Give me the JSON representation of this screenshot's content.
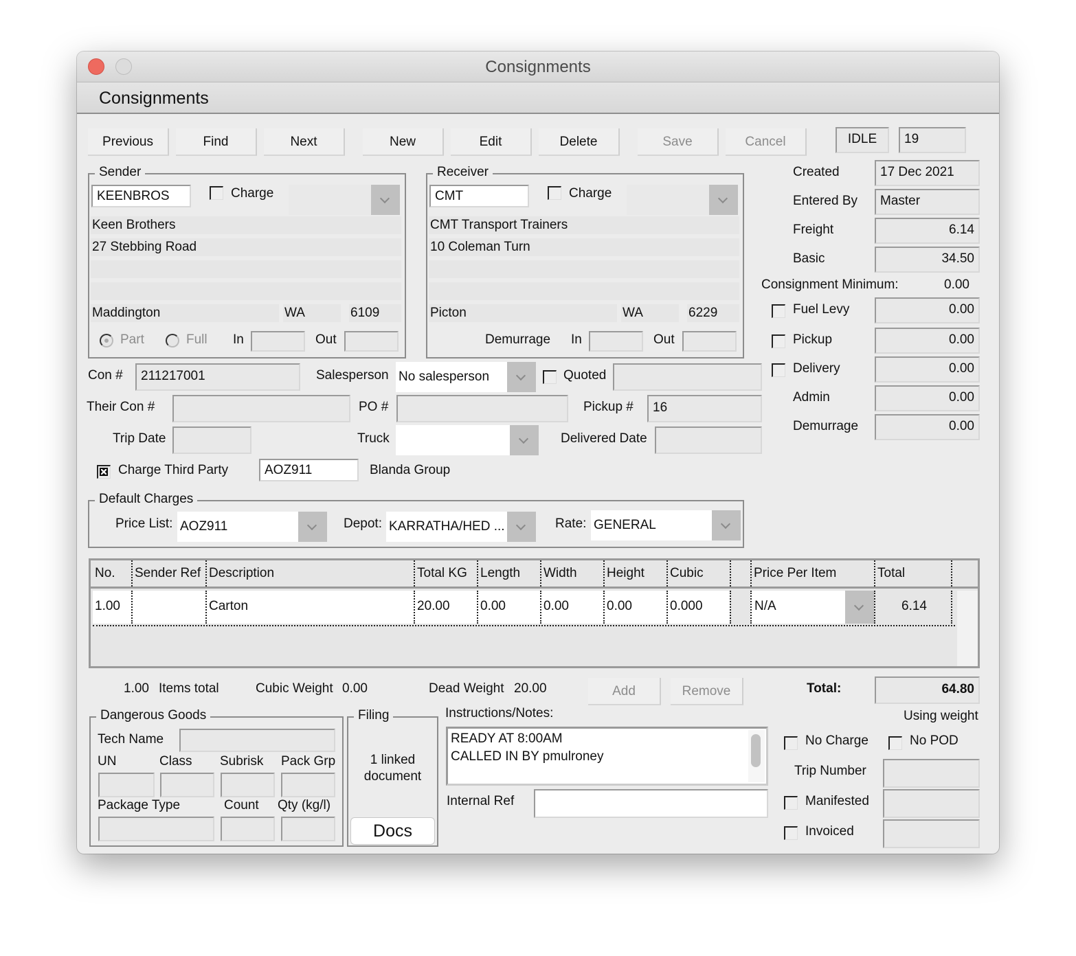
{
  "window": {
    "title": "Consignments",
    "header": "Consignments"
  },
  "toolbar": {
    "previous": "Previous",
    "find": "Find",
    "next": "Next",
    "new": "New",
    "edit": "Edit",
    "delete": "Delete",
    "save": "Save",
    "cancel": "Cancel",
    "status": "IDLE",
    "record_number": "19"
  },
  "sender": {
    "title": "Sender",
    "code": "KEENBROS",
    "charge_label": "Charge",
    "charge_checked": false,
    "name": "Keen Brothers",
    "address1": "27 Stebbing Road",
    "address2": "",
    "address3": "",
    "suburb": "Maddington",
    "state": "WA",
    "postcode": "6109",
    "part_label": "Part",
    "full_label": "Full",
    "in_label": "In",
    "out_label": "Out",
    "in_value": "",
    "out_value": ""
  },
  "receiver": {
    "title": "Receiver",
    "code": "CMT",
    "charge_label": "Charge",
    "charge_checked": false,
    "name": "CMT Transport Trainers",
    "address1": "10 Coleman Turn",
    "address2": "",
    "address3": "",
    "suburb": "Picton",
    "state": "WA",
    "postcode": "6229",
    "demurrage_label": "Demurrage",
    "in_label": "In",
    "out_label": "Out",
    "in_value": "",
    "out_value": ""
  },
  "summary": {
    "created_label": "Created",
    "created": "17 Dec 2021",
    "entered_by_label": "Entered By",
    "entered_by": "Master",
    "freight_label": "Freight",
    "freight": "6.14",
    "basic_label": "Basic",
    "basic": "34.50",
    "minimum_label": "Consignment Minimum:",
    "minimum": "0.00",
    "fuel_levy_label": "Fuel Levy",
    "fuel_levy": "0.00",
    "pickup_label": "Pickup",
    "pickup": "0.00",
    "delivery_label": "Delivery",
    "delivery": "0.00",
    "admin_label": "Admin",
    "admin": "0.00",
    "demurrage_label": "Demurrage",
    "demurrage": "0.00"
  },
  "details": {
    "con_label": "Con #",
    "con": "211217001",
    "salesperson_label": "Salesperson",
    "salesperson": "No salesperson",
    "quoted_label": "Quoted",
    "quoted_value": "",
    "their_con_label": "Their Con #",
    "their_con": "",
    "po_label": "PO #",
    "po": "",
    "pickup_no_label": "Pickup #",
    "pickup_no": "16",
    "trip_date_label": "Trip Date",
    "trip_date": "",
    "truck_label": "Truck",
    "truck": "",
    "delivered_date_label": "Delivered Date",
    "delivered_date": "",
    "third_party_label": "Charge Third Party",
    "third_party_checked": true,
    "third_party_code": "AOZ911",
    "third_party_name": "Blanda Group"
  },
  "default_charges": {
    "title": "Default Charges",
    "price_list_label": "Price List:",
    "price_list": "AOZ911",
    "depot_label": "Depot:",
    "depot": "KARRATHA/HED ...",
    "rate_label": "Rate:",
    "rate": "GENERAL"
  },
  "items": {
    "columns": [
      "No.",
      "Sender Ref",
      "Description",
      "Total KG",
      "Length",
      "Width",
      "Height",
      "Cubic",
      "",
      "Price Per Item",
      "Total"
    ],
    "rows": [
      {
        "no": "1.00",
        "sender_ref": "",
        "description": "Carton",
        "total_kg": "20.00",
        "length": "0.00",
        "width": "0.00",
        "height": "0.00",
        "cubic": "0.000",
        "price_per_item": "N/A",
        "total": "6.14"
      }
    ]
  },
  "totals": {
    "items_total_value": "1.00",
    "items_total_label": "Items total",
    "cubic_weight_label": "Cubic Weight",
    "cubic_weight": "0.00",
    "dead_weight_label": "Dead Weight",
    "dead_weight": "20.00",
    "add": "Add",
    "remove": "Remove",
    "total_label": "Total:",
    "total": "64.80",
    "using": "Using weight"
  },
  "dangerous_goods": {
    "title": "Dangerous Goods",
    "tech_name_label": "Tech Name",
    "un_label": "UN",
    "class_label": "Class",
    "subrisk_label": "Subrisk",
    "pack_grp_label": "Pack Grp",
    "package_type_label": "Package Type",
    "count_label": "Count",
    "qty_label": "Qty (kg/l)"
  },
  "filing": {
    "title": "Filing",
    "linked_line1": "1 linked",
    "linked_line2": "document",
    "docs": "Docs"
  },
  "notes": {
    "label": "Instructions/Notes:",
    "line1": "READY AT 8:00AM",
    "line2": "CALLED IN BY pmulroney",
    "internal_ref_label": "Internal Ref",
    "internal_ref": ""
  },
  "flags": {
    "no_charge_label": "No Charge",
    "no_pod_label": "No POD",
    "trip_number_label": "Trip Number",
    "manifested_label": "Manifested",
    "invoiced_label": "Invoiced"
  },
  "colors": {
    "close_button": "#ee6a5f",
    "window_bg": "#ececec",
    "field_bg": "#e8e8e8",
    "combo_arrow_bg": "#c0c0c0"
  }
}
